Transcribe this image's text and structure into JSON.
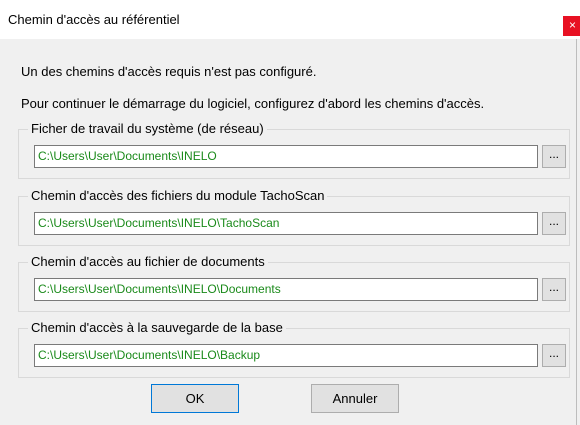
{
  "window": {
    "title": "Chemin d'accès au référentiel",
    "close_symbol": "×"
  },
  "messages": {
    "line1": "Un des chemins d'accès requis n'est pas configuré.",
    "line2": "Pour continuer le démarrage du logiciel, configurez d'abord les chemins d'accès."
  },
  "groups": [
    {
      "label": "Ficher de travail du système (de réseau)",
      "path": "C:\\Users\\User\\Documents\\INELO",
      "browse_label": "..."
    },
    {
      "label": "Chemin d'accès des fichiers du module TachoScan",
      "path": "C:\\Users\\User\\Documents\\INELO\\TachoScan",
      "browse_label": "..."
    },
    {
      "label": "Chemin d'accès au fichier de documents",
      "path": "C:\\Users\\User\\Documents\\INELO\\Documents",
      "browse_label": "..."
    },
    {
      "label": "Chemin d'accès à la sauvegarde de la base",
      "path": "C:\\Users\\User\\Documents\\INELO\\Backup",
      "browse_label": "..."
    }
  ],
  "buttons": {
    "ok": "OK",
    "cancel": "Annuler"
  },
  "colors": {
    "path_text": "#1a8a1a",
    "close_bg": "#e81123",
    "dialog_bg": "#f0f0f0"
  }
}
